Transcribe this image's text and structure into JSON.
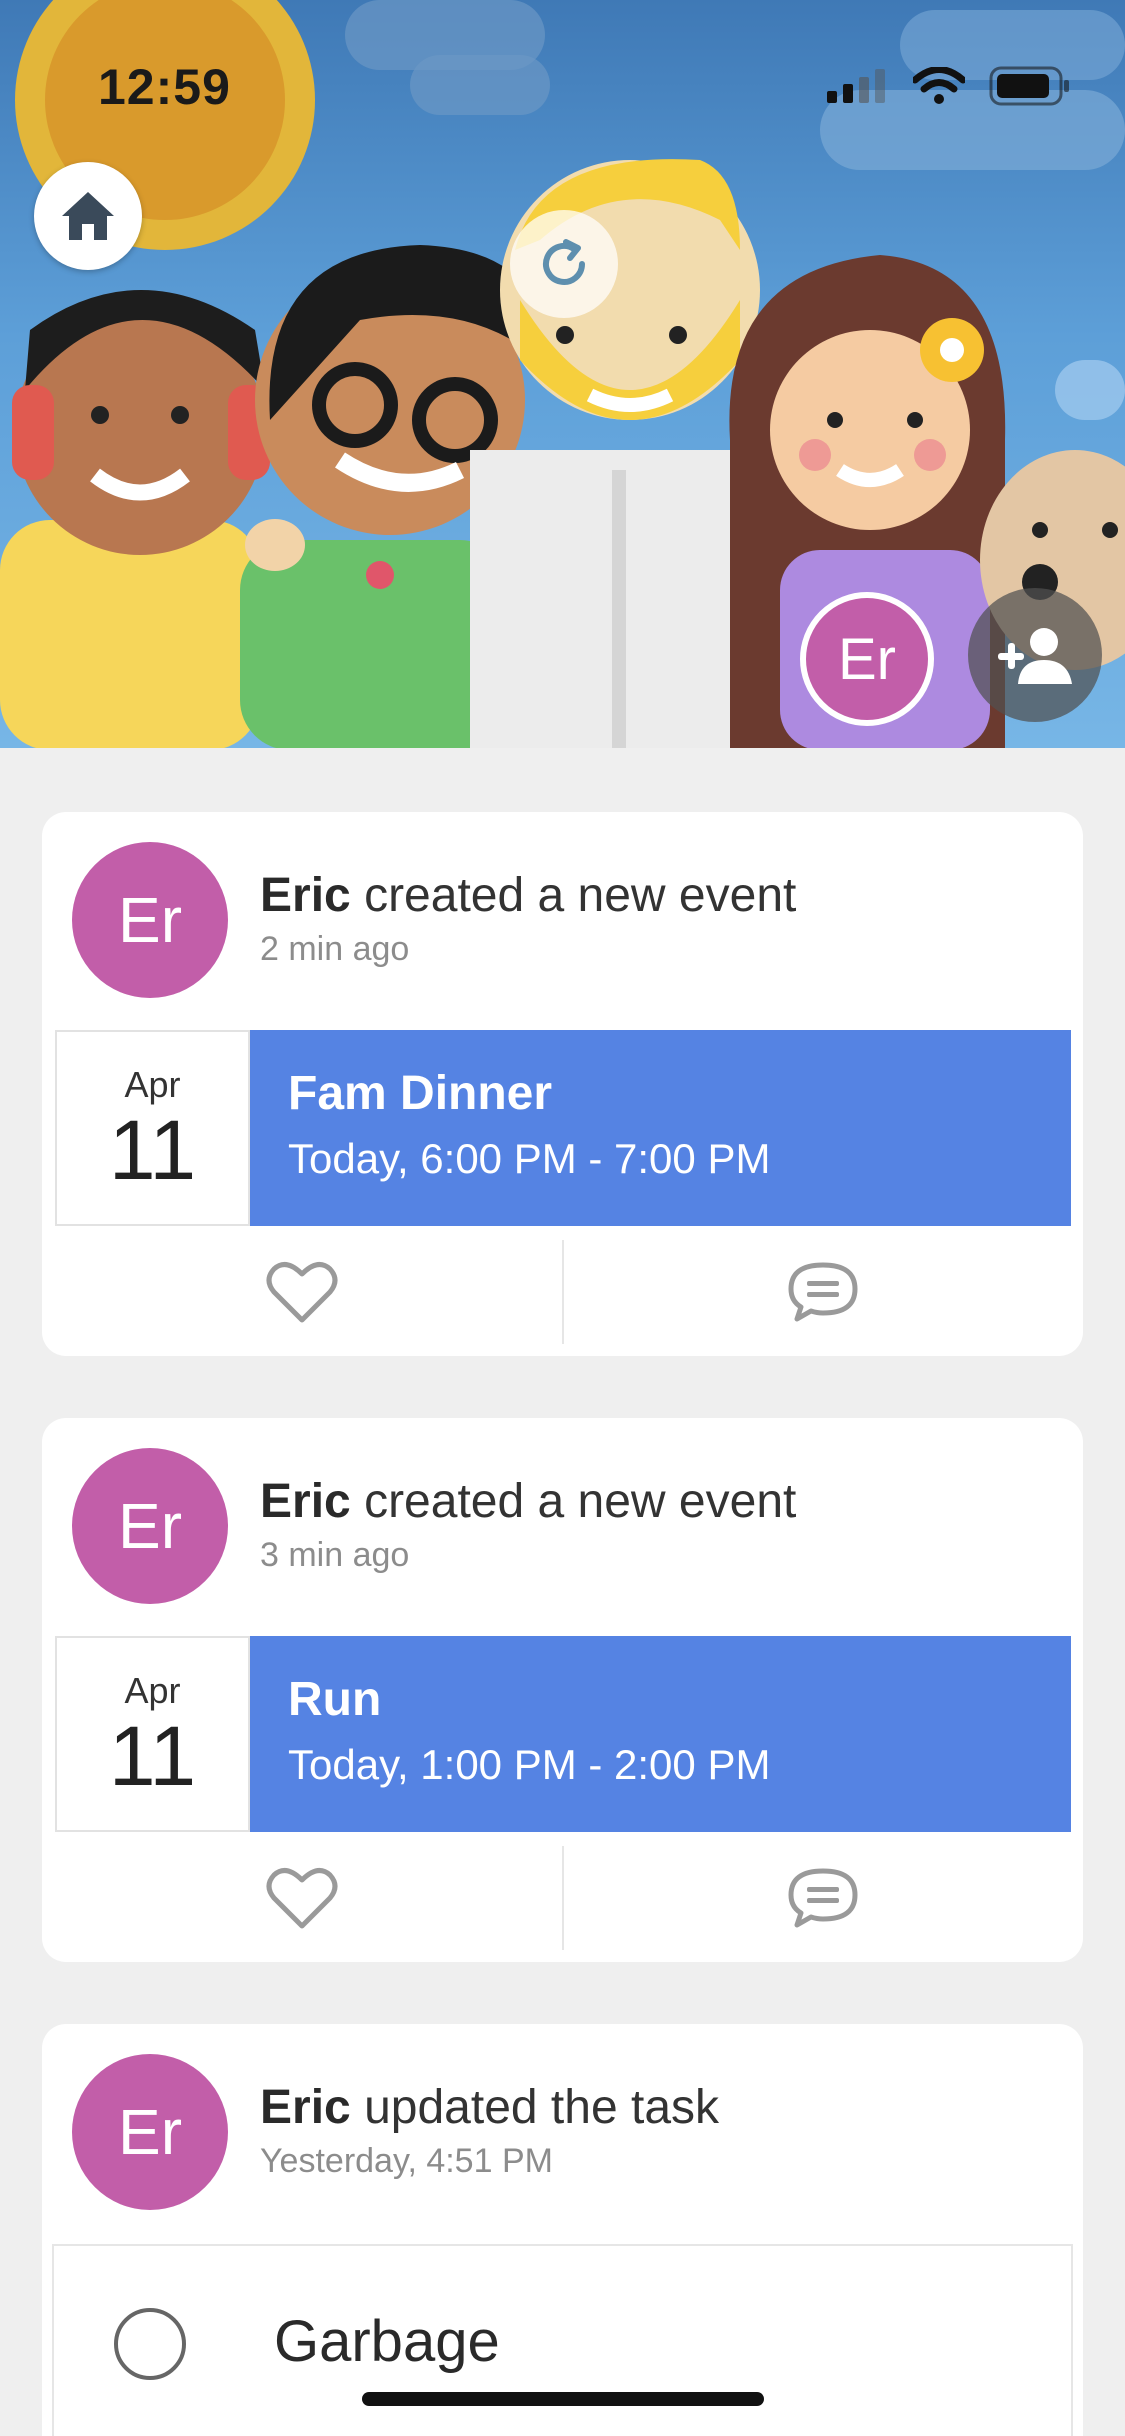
{
  "status_bar": {
    "time": "12:59",
    "icons": [
      "signal-icon",
      "wifi-icon",
      "battery-icon"
    ]
  },
  "hero": {
    "home_icon": "home-icon",
    "refresh_icon": "refresh-icon",
    "member_avatar": "Er",
    "add_member_icon": "add-person-icon",
    "avatar_color": "#c25ea9"
  },
  "feed": [
    {
      "avatar": "Er",
      "actor": "Eric",
      "action": " created a new event",
      "time": "2 min ago",
      "event": {
        "month": "Apr",
        "day": "11",
        "title": "Fam Dinner",
        "when": "Today, 6:00 PM - 7:00 PM",
        "color": "#5583e3"
      },
      "actions": {
        "like_icon": "heart-icon",
        "comment_icon": "comment-icon"
      }
    },
    {
      "avatar": "Er",
      "actor": "Eric",
      "action": " created a new event",
      "time": "3 min ago",
      "event": {
        "month": "Apr",
        "day": "11",
        "title": "Run",
        "when": "Today, 1:00 PM - 2:00 PM",
        "color": "#5583e3"
      },
      "actions": {
        "like_icon": "heart-icon",
        "comment_icon": "comment-icon"
      }
    },
    {
      "avatar": "Er",
      "actor": "Eric",
      "action": " updated the task",
      "time": "Yesterday, 4:51 PM",
      "task": {
        "name": "Garbage",
        "done": false
      }
    }
  ]
}
